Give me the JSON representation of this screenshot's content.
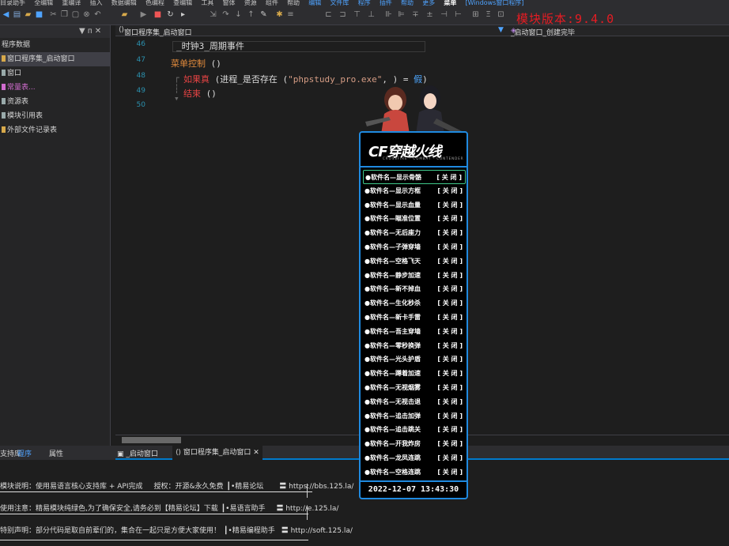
{
  "menubar": {
    "items": [
      "目录助手",
      "全编辑",
      "重编译",
      "插入",
      "数据编辑",
      "色编程",
      "查编辑",
      "工具",
      "窗体",
      "资源",
      "组件",
      "帮助"
    ],
    "accent_items": [
      "编辑",
      "文件库",
      "程序",
      "插件",
      "帮助",
      "更多"
    ],
    "highlight": "菜单",
    "extra": "[Windows窗口程序]"
  },
  "toolbar": {
    "version": "模块版本:9.4.0"
  },
  "left_panel": {
    "header_pin": "▼ ᴨ ✕",
    "items": [
      {
        "label": "程序数据"
      },
      {
        "label": "窗口程序集_启动窗口"
      },
      {
        "label": "窗口"
      },
      {
        "label": "常量表..."
      },
      {
        "label": "资源表"
      },
      {
        "label": "模块引用表"
      },
      {
        "label": "外部文件记录表"
      }
    ],
    "tabs": [
      "支持库",
      "程序",
      "属性"
    ]
  },
  "editor": {
    "title": "窗口程序集_启动窗口",
    "method": "_启动窗口_创建完毕",
    "line_numbers": [
      "46",
      "47",
      "48",
      "49",
      "50"
    ],
    "code": {
      "l46": "_时钟3_周期事件",
      "l47_name": "菜单控制",
      "l47_paren": " ()",
      "l48_kw": "如果真",
      "l48_a": " (进程_是否存在 (",
      "l48_str": "\"phpstudy_pro.exe\"",
      "l48_b": ", ) = ",
      "l48_val": "假",
      "l48_c": ")",
      "l49_kw": "结束",
      "l49_paren": " ()"
    }
  },
  "doc_tabs": [
    "_启动窗口",
    "窗口程序集_启动窗口"
  ],
  "output": {
    "lines": [
      {
        "a": "模块说明：使用易语言核心支持库 + API完成",
        "b": "授权：开源&永久免费",
        "c": "┃•精易论坛",
        "d": "〓 https://bbs.125.la/"
      },
      {
        "a": "使用注意：精易模块纯绿色,为了确保安全,请务必到【精易论坛】下载",
        "b": "",
        "c": "┃•易语言助手",
        "d": "〓 http://e.125.la/"
      },
      {
        "a": "特别声明：部分代码是取自前辈们的，集合在一起只是方便大家使用！",
        "b": "",
        "c": "┃•精易编程助手",
        "d": "〓 http://soft.125.la/"
      }
    ]
  },
  "game_panel": {
    "logo": "穿越火线",
    "logo_sub": "CROSSFIRE · COMBAT · CONTENDER",
    "items": [
      {
        "name": "●软件名—显示骨骼",
        "action": "[ 关 闭 ]"
      },
      {
        "name": "●软件名—显示方框",
        "action": "[ 关 闭 ]"
      },
      {
        "name": "●软件名—显示血量",
        "action": "[ 关 闭 ]"
      },
      {
        "name": "●软件名—瞄准位置",
        "action": "[ 关 闭 ]"
      },
      {
        "name": "●软件名—无后座力",
        "action": "[ 关 闭 ]"
      },
      {
        "name": "●软件名—子弹穿墙",
        "action": "[ 关 闭 ]"
      },
      {
        "name": "●软件名—空格飞天",
        "action": "[ 关 闭 ]"
      },
      {
        "name": "●软件名—静步加速",
        "action": "[ 关 闭 ]"
      },
      {
        "name": "●软件名—新不掉血",
        "action": "[ 关 闭 ]"
      },
      {
        "name": "●软件名—生化秒杀",
        "action": "[ 关 闭 ]"
      },
      {
        "name": "●软件名—新卡手雷",
        "action": "[ 关 闭 ]"
      },
      {
        "name": "●软件名—吾主穿墙",
        "action": "[ 关 闭 ]"
      },
      {
        "name": "●软件名—零秒换弹",
        "action": "[ 关 闭 ]"
      },
      {
        "name": "●软件名—光头护盾",
        "action": "[ 关 闭 ]"
      },
      {
        "name": "●软件名—蹲着加速",
        "action": "[ 关 闭 ]"
      },
      {
        "name": "●软件名—无视烟雾",
        "action": "[ 关 闭 ]"
      },
      {
        "name": "●软件名—无视击退",
        "action": "[ 关 闭 ]"
      },
      {
        "name": "●软件名—追击加弹",
        "action": "[ 关 闭 ]"
      },
      {
        "name": "●软件名—追击跳关",
        "action": "[ 关 闭 ]"
      },
      {
        "name": "●软件名—开我炸房",
        "action": "[ 关 闭 ]"
      },
      {
        "name": "●软件名—龙凤连跳",
        "action": "[ 关 闭 ]"
      },
      {
        "name": "●软件名—空格连跳",
        "action": "[ 关 闭 ]"
      }
    ],
    "datetime": "2022-12-07 13:43:30"
  },
  "colors": {
    "accent": "#1f8ae0",
    "version_red": "#e51c23",
    "ide_bg": "#1e1e1e"
  }
}
